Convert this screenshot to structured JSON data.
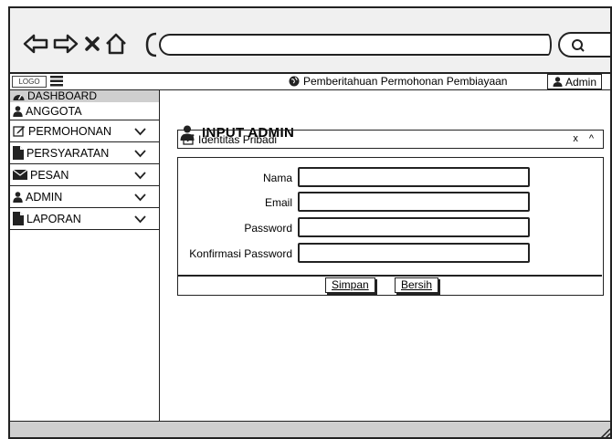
{
  "browser": {
    "back_icon": "back-arrow-icon",
    "forward_icon": "forward-arrow-icon",
    "close_icon": "close-icon",
    "home_icon": "home-icon",
    "search_icon": "search-icon",
    "url": ""
  },
  "header": {
    "logo": "LOGO",
    "notification": "Pemberitahuan Permohonan Pembiayaan",
    "admin": "Admin"
  },
  "sidebar": {
    "dashboard": "DASHBOARD",
    "items": [
      {
        "label": "ANGGOTA",
        "icon": "user-icon",
        "chevron": false
      },
      {
        "label": "PERMOHONAN",
        "icon": "edit-icon",
        "chevron": true
      },
      {
        "label": "PERSYARATAN",
        "icon": "file-icon",
        "chevron": true
      },
      {
        "label": "PESAN",
        "icon": "envelope-icon",
        "chevron": true
      },
      {
        "label": "ADMIN",
        "icon": "user-icon",
        "chevron": true
      },
      {
        "label": "LAPORAN",
        "icon": "file-icon",
        "chevron": true
      }
    ]
  },
  "main": {
    "title": "INPUT ADMIN",
    "panel_title": "Identitas Pribadi",
    "panel_close": "x",
    "panel_collapse": "^",
    "form": {
      "nama_label": "Nama",
      "nama_value": "",
      "email_label": "Email",
      "email_value": "",
      "password_label": "Password",
      "password_value": "",
      "konfirmasi_label": "Konfirmasi Password",
      "konfirmasi_value": ""
    },
    "buttons": {
      "save": "Simpan",
      "clear": "Bersih"
    }
  }
}
